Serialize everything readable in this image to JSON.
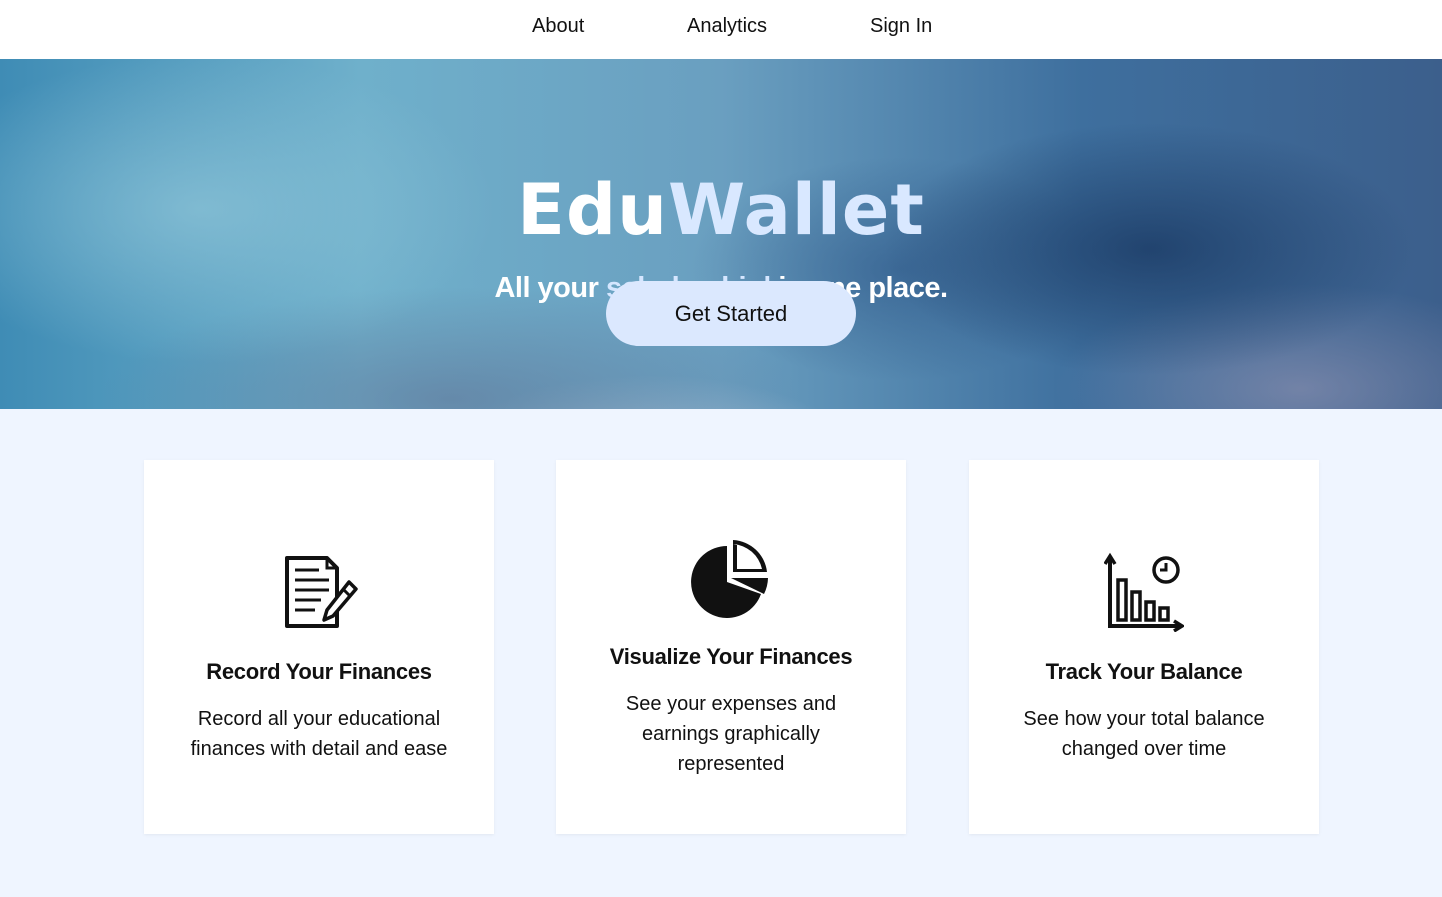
{
  "nav": {
    "items": [
      {
        "label": "About"
      },
      {
        "label": "Analytics"
      },
      {
        "label": "Sign In"
      }
    ]
  },
  "hero": {
    "title_part1": "Edu",
    "title_part2": "Wallet",
    "subtitle_prefix": "All your ",
    "subtitle_highlight": "scholarship|",
    "subtitle_suffix": " in one place.",
    "cta_label": "Get Started"
  },
  "features": [
    {
      "icon": "document-pencil-icon",
      "title": "Record Your Finances",
      "text": "Record all your educational finances with detail and ease"
    },
    {
      "icon": "pie-chart-icon",
      "title": "Visualize Your Finances",
      "text": "See your expenses and earnings graphically represented"
    },
    {
      "icon": "bar-chart-clock-icon",
      "title": "Track Your Balance",
      "text": "See how your total balance changed over time"
    }
  ],
  "colors": {
    "page_background": "#eff5ff",
    "cta_background": "#dbe8fe",
    "title_accent": "#d9e8ff"
  }
}
